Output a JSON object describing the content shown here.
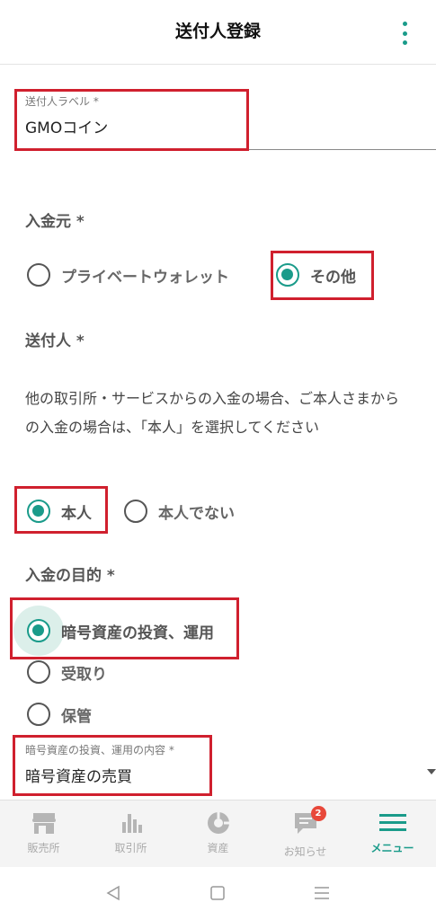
{
  "header": {
    "title": "送付人登録"
  },
  "sender_label_field": {
    "label": "送付人ラベル *",
    "value": "GMOコイン"
  },
  "deposit_source": {
    "title": "入金元 *",
    "options": [
      {
        "label": "プライベートウォレット",
        "selected": false
      },
      {
        "label": "その他",
        "selected": true
      }
    ]
  },
  "sender": {
    "title": "送付人 *",
    "description": "他の取引所・サービスからの入金の場合、ご本人さまからの入金の場合は、「本人」を選択してください",
    "options": [
      {
        "label": "本人",
        "selected": true
      },
      {
        "label": "本人でない",
        "selected": false
      }
    ]
  },
  "purpose": {
    "title": "入金の目的 *",
    "options": [
      {
        "label": "暗号資産の投資、運用",
        "selected": true
      },
      {
        "label": "受取り",
        "selected": false
      },
      {
        "label": "保管",
        "selected": false
      }
    ]
  },
  "purpose_detail_field": {
    "label": "暗号資産の投資、運用の内容 *",
    "value": "暗号資産の売買"
  },
  "bottom_nav": {
    "items": [
      {
        "label": "販売所",
        "icon": "shop-icon",
        "active": false
      },
      {
        "label": "取引所",
        "icon": "bar-chart-icon",
        "active": false
      },
      {
        "label": "資産",
        "icon": "pie-chart-icon",
        "active": false
      },
      {
        "label": "お知らせ",
        "icon": "message-icon",
        "active": false,
        "badge": "2"
      },
      {
        "label": "メニュー",
        "icon": "hamburger-icon",
        "active": true
      }
    ]
  },
  "colors": {
    "accent": "#1a9b8a",
    "highlight": "#d0202e",
    "badge": "#e8483a"
  }
}
